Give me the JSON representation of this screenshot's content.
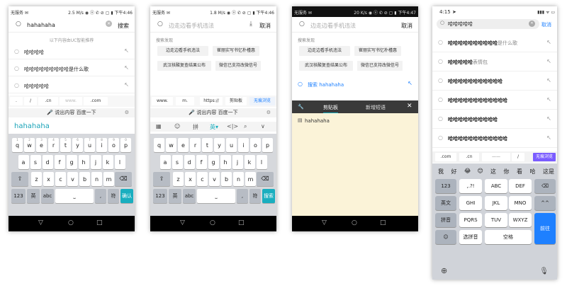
{
  "p1": {
    "status_left": "无服务 ✉",
    "status_right": "2.5 M/s ◉ ⓝ ✆ ⊘ ▢ ▮ 下午4:46",
    "query": "hahahaha",
    "search_btn": "搜索",
    "hint": "以下内容由UC智能推荐",
    "suggestions": [
      "哈哈哈哈",
      "哈哈哈哈哈哈哈哈哈是什么歌",
      "哈哈哈哈哈"
    ],
    "quick_keys": [
      ".",
      "/",
      ".cn",
      "www.",
      ".com"
    ],
    "voice_label": "说出内容 百度一下",
    "composition": "hahahaha",
    "rows": [
      [
        "q",
        "w",
        "e",
        "r",
        "t",
        "y",
        "u",
        "i",
        "o",
        "p"
      ],
      [
        "a",
        "s",
        "d",
        "f",
        "g",
        "h",
        "j",
        "k",
        "l"
      ],
      [
        "z",
        "x",
        "c",
        "v",
        "b",
        "n",
        "m"
      ]
    ],
    "row1_nums": [
      "1",
      "2",
      "3",
      "4",
      "5",
      "6",
      "7",
      "8",
      "9",
      "0"
    ],
    "bottom_keys": [
      "123",
      "英",
      "abc",
      ",",
      "符",
      "确认"
    ]
  },
  "p2": {
    "status_left": "无服务 ✉",
    "status_right": "1.8 M/s ◉ ⓝ ✆ ⊘ ▢ ▮ 下午4:46",
    "placeholder": "边走边看手机违法",
    "cancel": "取消",
    "section": "搜索发现",
    "chips": [
      "边走边看手机违法",
      "崔丽实写书忆朴槿惠",
      "武汉核酸复查结果公布",
      "微信已支持改微信号"
    ],
    "quick_keys": [
      "www.",
      "m.",
      "https://",
      "剪贴板",
      "无痕浏览"
    ],
    "voice_label": "说出内容 百度一下",
    "tool_labels": [
      "▦",
      "☺",
      "拼",
      "英▾",
      "<|>",
      "⌕",
      "∨"
    ],
    "rows": [
      [
        "q",
        "w",
        "e",
        "r",
        "t",
        "y",
        "u",
        "i",
        "o",
        "p"
      ],
      [
        "a",
        "s",
        "d",
        "f",
        "g",
        "h",
        "j",
        "k",
        "l"
      ],
      [
        "z",
        "x",
        "c",
        "v",
        "b",
        "n",
        "m"
      ]
    ],
    "bottom_keys": [
      "123",
      "英",
      "abc",
      ",",
      "符",
      "搜索"
    ]
  },
  "p3": {
    "status_left": "无服务 ✉",
    "status_right": "20 K/s ◉ ⓝ ✆ ⊘ ▢ ▮ 下午4:47",
    "placeholder": "边走边看手机违法",
    "cancel": "取消",
    "section": "搜索发现",
    "chips": [
      "边走边看手机违法",
      "崔丽实写书忆朴槿惠",
      "武汉核酸复查结果公布",
      "微信已支持改微信号"
    ],
    "search_link": "搜索 hahahaha",
    "tab_clip": "剪贴板",
    "tab_new": "新增短语",
    "clip_item": "hahahaha"
  },
  "p4": {
    "time": "4:15 ➤",
    "status_right": "▮▮▮ ᯤ ▭",
    "query": "哈哈哈哈哈",
    "cancel": "取消",
    "suggestions": [
      {
        "bold": "哈哈哈哈哈哈哈哈哈哈",
        "rest": "是什么歌"
      },
      {
        "bold": "哈哈哈哈哈",
        "rest": "表情包"
      },
      {
        "bold": "哈哈哈哈哈哈哈哈哈哈哈",
        "rest": ""
      },
      {
        "bold": "哈哈哈哈哈哈哈哈哈哈哈哈",
        "rest": ""
      },
      {
        "bold": "哈哈哈哈哈哈哈哈哈哈",
        "rest": ""
      },
      {
        "bold": "哈哈哈哈哈哈哈哈哈哈哈哈",
        "rest": ""
      }
    ],
    "quick_keys": [
      ".com",
      ".cn",
      "——",
      "/",
      "无痕浏览"
    ],
    "candidates": [
      "我",
      "好",
      "😂",
      "😊",
      "这",
      "你",
      "看",
      "哈",
      "这是"
    ],
    "key_grid": [
      [
        "123",
        ",.?!",
        "ABC",
        "DEF",
        "⌫"
      ],
      [
        "英文",
        "GHI",
        "JKL",
        "MNO",
        "^^"
      ],
      [
        "拼音",
        "PQRS",
        "TUV",
        "WXYZ",
        "前往"
      ],
      [
        "☺",
        "选拼音",
        "空格"
      ]
    ],
    "globe": "⊕",
    "mic": "🎙"
  },
  "colors": {
    "teal": "#19aebf",
    "blue": "#1e80ff",
    "clip_bg": "#fbf3d8"
  }
}
